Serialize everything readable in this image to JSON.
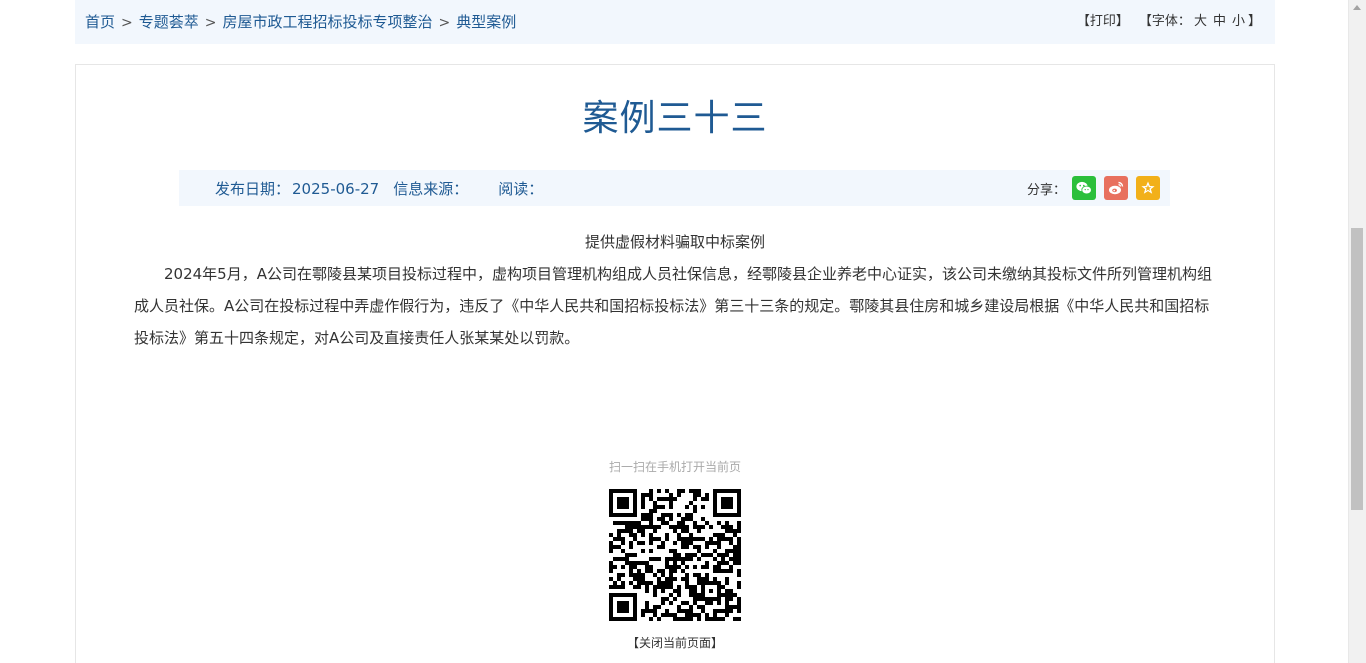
{
  "breadcrumb": {
    "items": [
      "首页",
      "专题荟萃",
      "房屋市政工程招标投标专项整治",
      "典型案例"
    ],
    "separator": ">"
  },
  "tools": {
    "print_label": "【打印】",
    "font_prefix": "【字体：",
    "font_large": "大",
    "font_medium": "中",
    "font_small": "小",
    "font_suffix": "】"
  },
  "article": {
    "title": "案例三十三",
    "meta": {
      "date_label": "发布日期：",
      "date_value": "2025-06-27",
      "source_label": "信息来源：",
      "source_value": "",
      "read_label": "阅读："
    },
    "share_label": "分享：",
    "share_icons": [
      "wechat-icon",
      "weibo-icon",
      "favorite-star-icon"
    ],
    "subtitle": "提供虚假材料骗取中标案例",
    "paragraph": "2024年5月，A公司在鄠陵县某项目投标过程中，虚构项目管理机构组成人员社保信息，经鄠陵县企业养老中心证实，该公司未缴纳其投标文件所列管理机构组成人员社保。A公司在投标过程中弄虚作假行为，违反了《中华人民共和国招标投标法》第三十三条的规定。鄠陵其县住房和城乡建设局根据《中华人民共和国招标投标法》第五十四条规定，对A公司及直接责任人张某某处以罚款。"
  },
  "qr": {
    "tip": "扫一扫在手机打开当前页",
    "close_label": "【关闭当前页面】"
  },
  "colors": {
    "link_blue": "#1f5a93",
    "light_bar": "#f2f7fd",
    "wechat_green": "#2bbf3b",
    "weibo_red": "#e8705e",
    "favorite_yellow": "#f2b019"
  }
}
